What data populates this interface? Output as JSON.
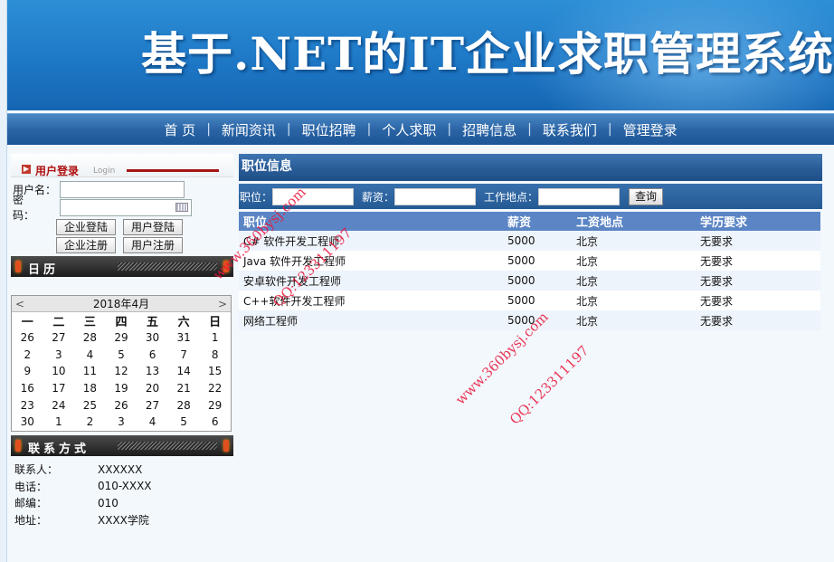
{
  "banner": {
    "title": "基于.NET的IT企业求职管理系统"
  },
  "nav": {
    "items": [
      "首 页",
      "新闻资讯",
      "职位招聘",
      "个人求职",
      "招聘信息",
      "联系我们",
      "管理登录"
    ],
    "separator": "|"
  },
  "login": {
    "title": "用户登录",
    "subtitle": "Login",
    "username_label": "用户名：",
    "password_label": "密　　码：",
    "buttons": [
      "企业登陆",
      "用户登陆",
      "企业注册",
      "用户注册"
    ]
  },
  "calendar_box": {
    "title": "日历"
  },
  "calendar": {
    "prev": "<",
    "next": ">",
    "month_label": "2018年4月",
    "weekdays": [
      "一",
      "二",
      "三",
      "四",
      "五",
      "六",
      "日"
    ],
    "weeks": [
      [
        "26",
        "27",
        "28",
        "29",
        "30",
        "31",
        "1"
      ],
      [
        "2",
        "3",
        "4",
        "5",
        "6",
        "7",
        "8"
      ],
      [
        "9",
        "10",
        "11",
        "12",
        "13",
        "14",
        "15"
      ],
      [
        "16",
        "17",
        "18",
        "19",
        "20",
        "21",
        "22"
      ],
      [
        "23",
        "24",
        "25",
        "26",
        "27",
        "28",
        "29"
      ],
      [
        "30",
        "1",
        "2",
        "3",
        "4",
        "5",
        "6"
      ]
    ]
  },
  "contact": {
    "title": "联系方式",
    "rows": [
      {
        "k": "联系人：",
        "v": "XXXXXX"
      },
      {
        "k": "电话：",
        "v": "010-XXXX"
      },
      {
        "k": "邮编：",
        "v": "010"
      },
      {
        "k": "地址：",
        "v": "XXXX学院"
      }
    ]
  },
  "jobs": {
    "title": "职位信息",
    "search": {
      "position_label": "职位：",
      "salary_label": "薪资：",
      "location_label": "工作地点：",
      "button": "查询"
    },
    "columns": [
      "职位",
      "薪资",
      "工资地点",
      "学历要求"
    ],
    "rows": [
      [
        "C# 软件开发工程师",
        "5000",
        "北京",
        "无要求"
      ],
      [
        "Java 软件开发工程师",
        "5000",
        "北京",
        "无要求"
      ],
      [
        "安卓软件开发工程师",
        "5000",
        "北京",
        "无要求"
      ],
      [
        "C++软件开发工程师",
        "5000",
        "北京",
        "无要求"
      ],
      [
        "网络工程师",
        "5000",
        "北京",
        "无要求"
      ]
    ]
  },
  "watermarks": [
    "www.360bysj.com",
    "QQ:123311197",
    "www.360bysj.com",
    "QQ:123311197"
  ],
  "colors": {
    "banner": "#1e78c6",
    "nav": "#2b65a6",
    "table_header": "#5b85c5",
    "login_title": "#b01010",
    "watermark": "#e8153a"
  }
}
